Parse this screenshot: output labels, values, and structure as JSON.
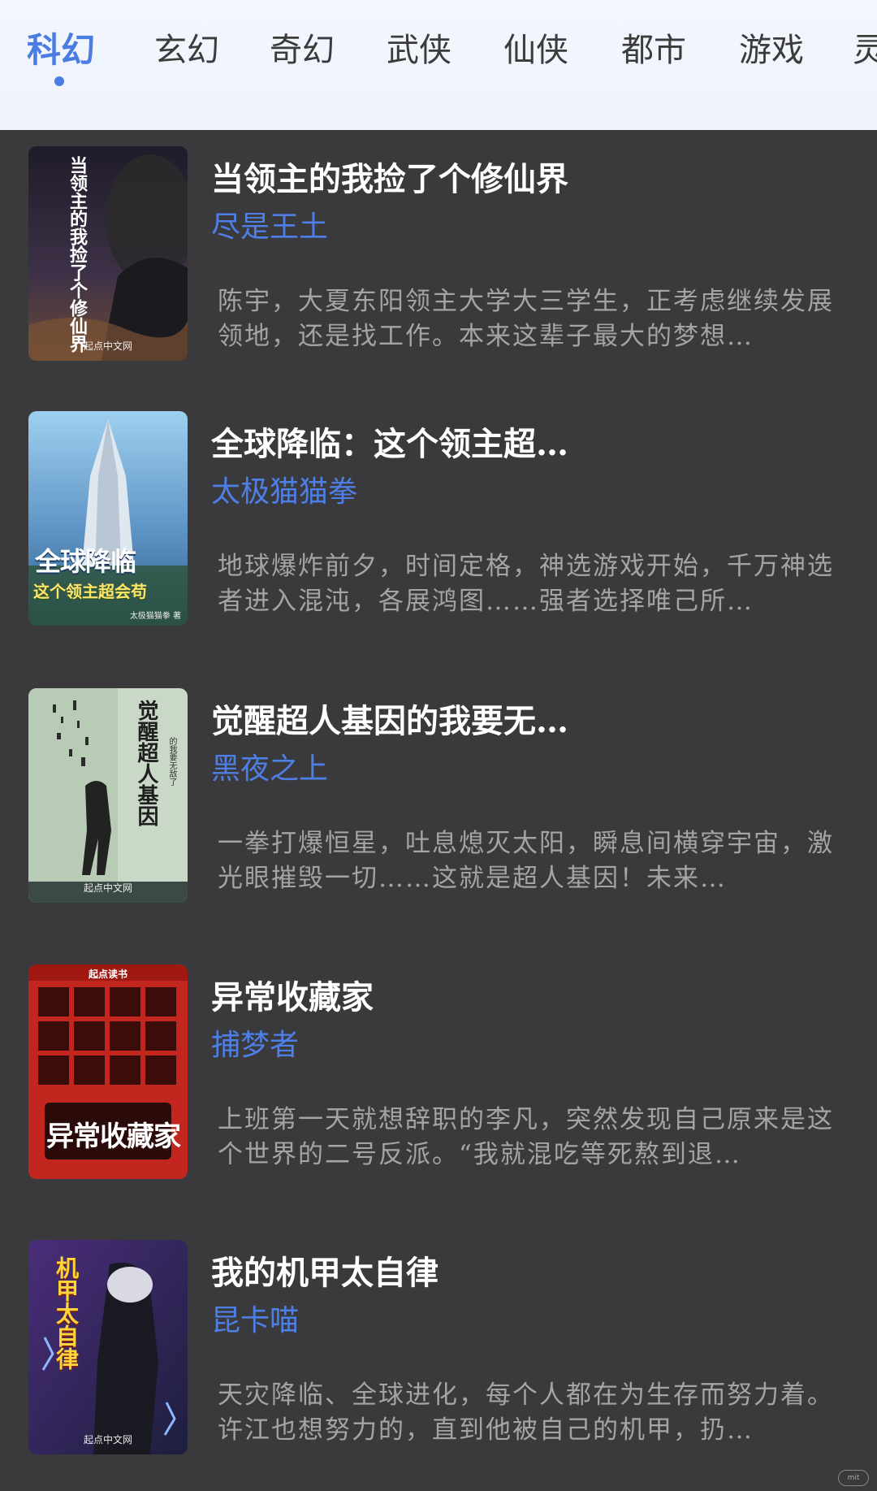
{
  "tabs": [
    {
      "label": "科幻",
      "active": true
    },
    {
      "label": "玄幻",
      "active": false
    },
    {
      "label": "奇幻",
      "active": false
    },
    {
      "label": "武侠",
      "active": false
    },
    {
      "label": "仙侠",
      "active": false
    },
    {
      "label": "都市",
      "active": false
    },
    {
      "label": "游戏",
      "active": false
    },
    {
      "label": "灵",
      "active": false
    }
  ],
  "books": [
    {
      "title": "当领主的我捡了个修仙界",
      "author": "尽是王土",
      "description": "陈宇，大夏东阳领主大学大三学生，正考虑继续发展领地，还是找工作。本来这辈子最大的梦想…",
      "cover": {
        "title": "当领主的我捡了个修仙界",
        "publisher": "起点中文网",
        "palette": "#2b2436"
      }
    },
    {
      "title": "全球降临：这个领主超…",
      "author": "太极猫猫拳",
      "description": "地球爆炸前夕，时间定格，神选游戏开始，千万神选者进入混沌，各展鸿图……强者选择唯己所…",
      "cover": {
        "title": "全球降临",
        "subtitle": "这个领主超会苟",
        "author_mark": "太极猫猫拳 著",
        "palette": "#6fa6d6"
      }
    },
    {
      "title": "觉醒超人基因的我要无…",
      "author": "黑夜之上",
      "description": "一拳打爆恒星，吐息熄灭太阳，瞬息间横穿宇宙，激光眼摧毁一切……这就是超人基因！未来…",
      "cover": {
        "title": "觉醒超人基因",
        "side_text": "的我要无敌了",
        "publisher": "起点中文网",
        "palette": "#c7d9c9"
      }
    },
    {
      "title": "异常收藏家",
      "author": "捕梦者",
      "description": "上班第一天就想辞职的李凡，突然发现自己原来是这个世界的二号反派。“我就混吃等死熬到退…",
      "cover": {
        "title": "异常收藏家",
        "top_label": "起点读书",
        "palette": "#c8261f"
      }
    },
    {
      "title": "我的机甲太自律",
      "author": "昆卡喵",
      "description": "天灾降临、全球进化，每个人都在为生存而努力着。许江也想努力的，直到他被自己的机甲，扔…",
      "cover": {
        "title": "机甲太自律",
        "publisher": "起点中文网",
        "palette": "#3a2f5c"
      }
    }
  ],
  "watermark": "mit"
}
